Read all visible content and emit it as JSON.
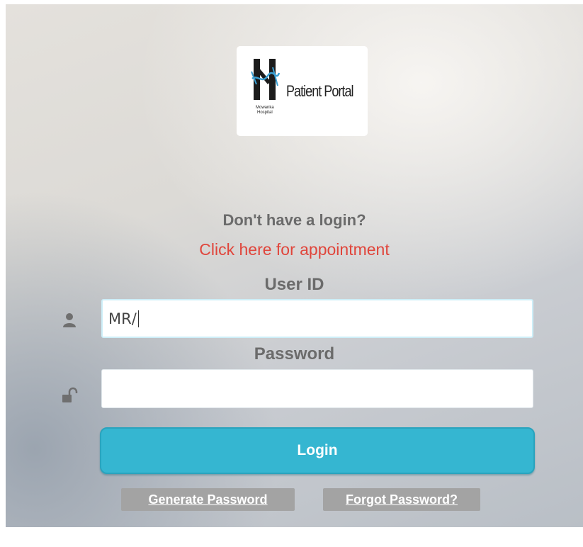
{
  "logo": {
    "title": "Patient Portal",
    "small_text": "Mowanka Hospital"
  },
  "prompt": {
    "no_login": "Don't have a login?",
    "appointment_link": "Click here for appointment"
  },
  "user_field": {
    "label": "User ID",
    "value": "MR/",
    "icon": "user-icon"
  },
  "password_field": {
    "label": "Password",
    "value": "",
    "icon": "unlock-icon"
  },
  "login_button": "Login",
  "links": {
    "generate_password": "Generate Password",
    "forgot_password": "Forgot Password?"
  },
  "colors": {
    "accent": "#35b6d1",
    "link": "#e0453b",
    "label": "#6b6b6b",
    "secondary_button": "#a3a3a3"
  }
}
